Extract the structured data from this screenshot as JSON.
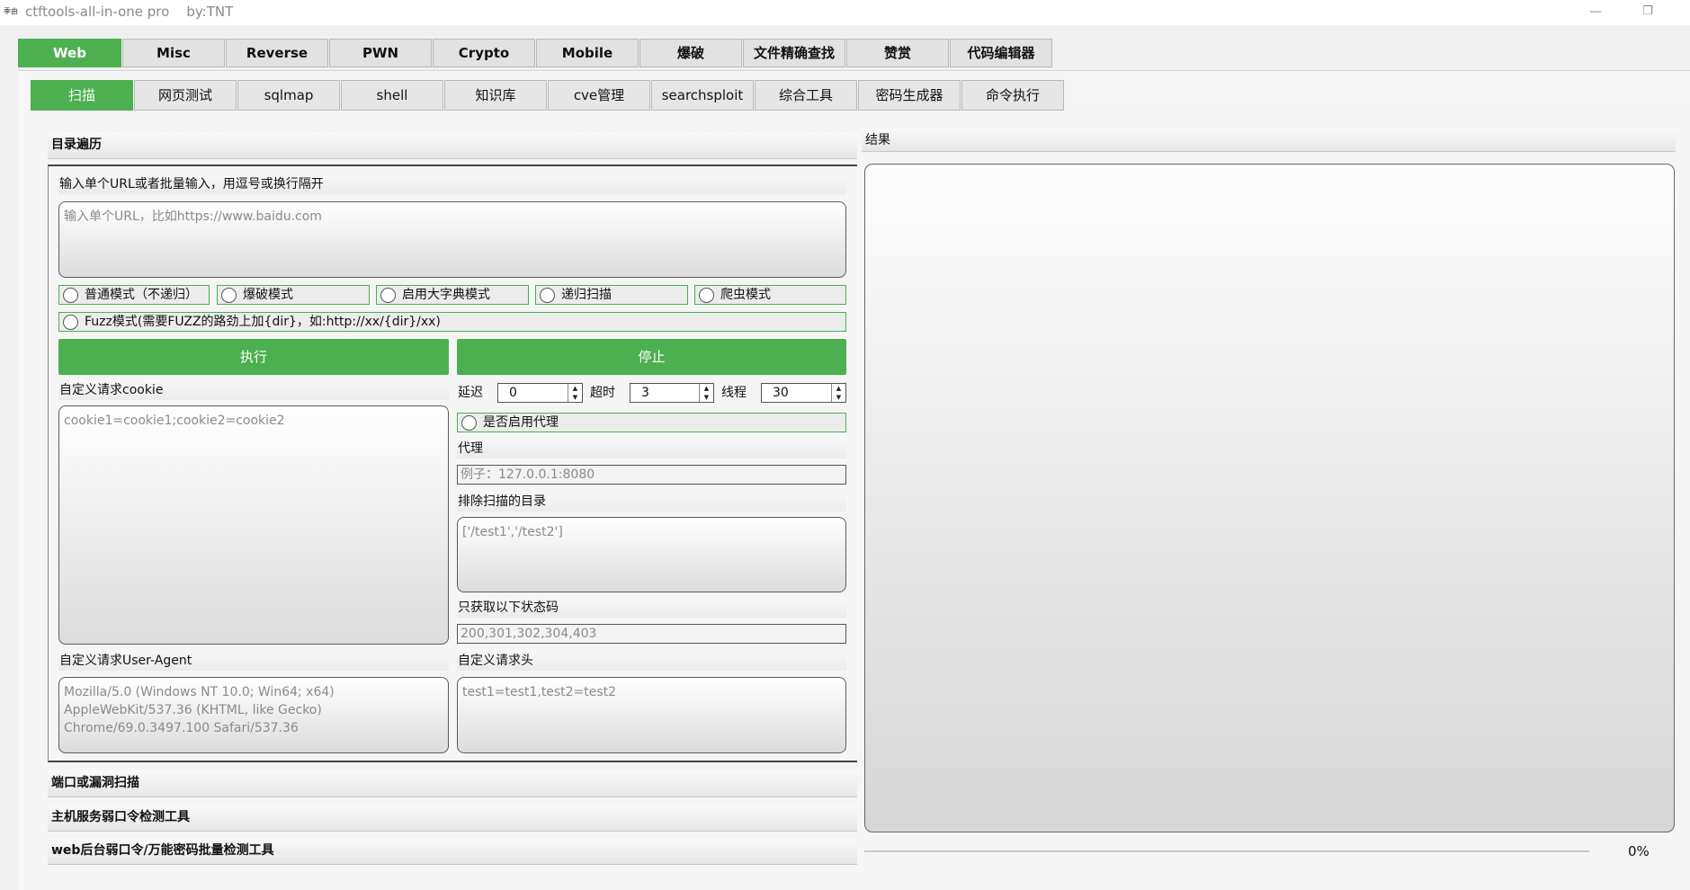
{
  "window": {
    "icon_text": "季由",
    "title": "ctftools-all-in-one pro    by:TNT",
    "minimize_glyph": "—",
    "restore_glyph": "❐"
  },
  "main_tabs": [
    "Web",
    "Misc",
    "Reverse",
    "PWN",
    "Crypto",
    "Mobile",
    "爆破",
    "文件精确查找",
    "赞赏",
    "代码编辑器"
  ],
  "sub_tabs": [
    "扫描",
    "网页测试",
    "sqlmap",
    "shell",
    "知识库",
    "cve管理",
    "searchsploit",
    "综合工具",
    "密码生成器",
    "命令执行"
  ],
  "sections": {
    "dir_traversal": "目录遍历",
    "port_scan": "端口或漏洞扫描",
    "host_weak": "主机服务弱口令检测工具",
    "web_weak": "web后台弱口令/万能密码批量检测工具"
  },
  "dir": {
    "url_label": "输入单个URL或者批量输入，用逗号或换行隔开",
    "url_placeholder": "输入单个URL，比如https://www.baidu.com",
    "modes": [
      "普通模式（不递归）",
      "爆破模式",
      "启用大字典模式",
      "递归扫描",
      "爬虫模式"
    ],
    "fuzz_mode": "Fuzz模式(需要FUZZ的路劲上加{dir}，如:http://xx/{dir}/xx)",
    "run_button": "执行",
    "stop_button": "停止",
    "cookie_label": "自定义请求cookie",
    "cookie_placeholder": "cookie1=cookie1;cookie2=cookie2",
    "delay_label": "延迟",
    "delay_value": "0",
    "timeout_label": "超时",
    "timeout_value": "3",
    "threads_label": "线程",
    "threads_value": "30",
    "proxy_enable": "是否启用代理",
    "proxy_label": "代理",
    "proxy_placeholder": "例子：127.0.0.1:8080",
    "exclude_label": "排除扫描的目录",
    "exclude_placeholder": "['/test1','/test2']",
    "status_label": "只获取以下状态码",
    "status_placeholder": "200,301,302,304,403",
    "ua_label": "自定义请求User-Agent",
    "ua_placeholder": "Mozilla/5.0 (Windows NT 10.0; Win64; x64) AppleWebKit/537.36 (KHTML, like Gecko) Chrome/69.0.3497.100 Safari/537.36",
    "headers_label": "自定义请求头",
    "headers_placeholder": "test1=test1,test2=test2"
  },
  "result": {
    "label": "结果",
    "progress_text": "0%",
    "progress_value": 0
  },
  "colors": {
    "accent": "#4caf50"
  }
}
